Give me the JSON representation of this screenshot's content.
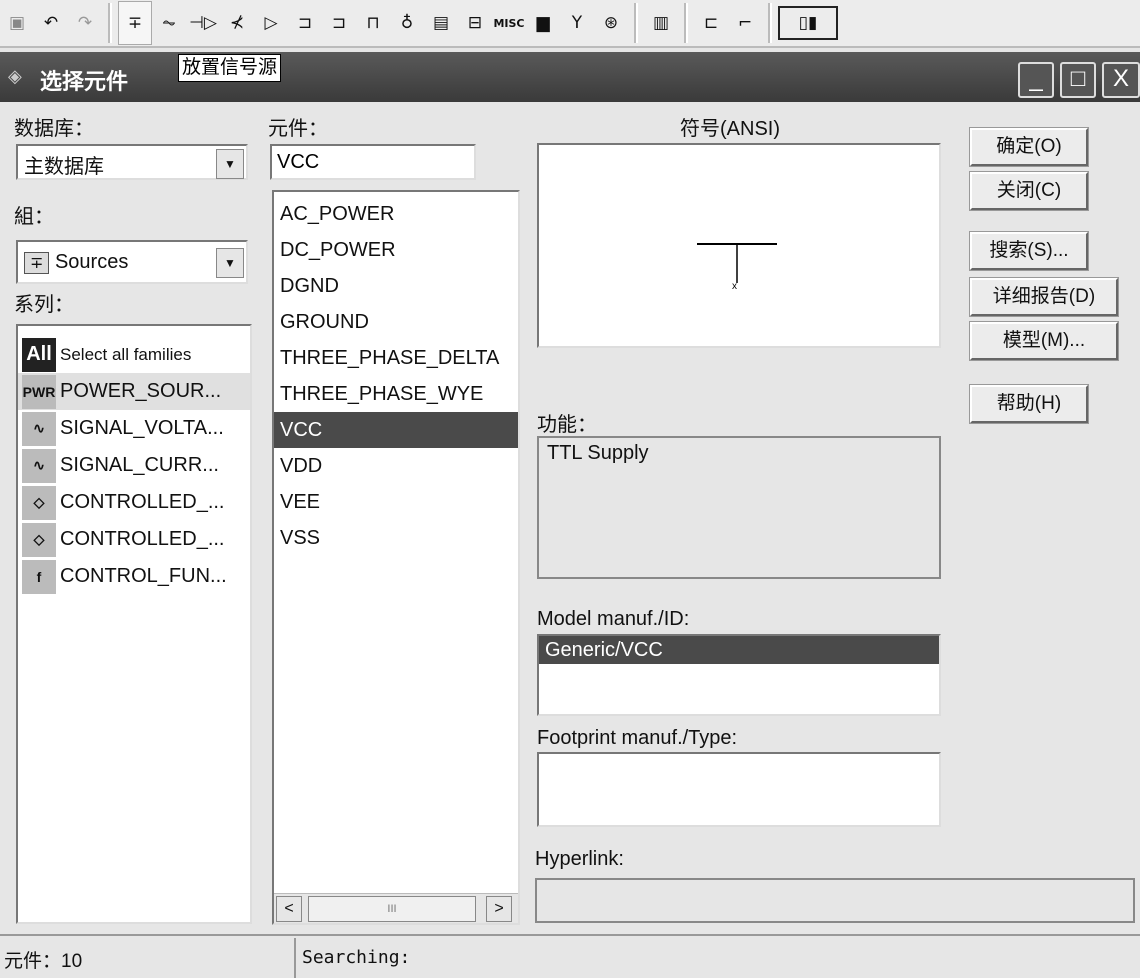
{
  "toolbar": {
    "icons": [
      "paste-icon",
      "undo-icon",
      "redo-icon",
      "source-icon",
      "resistor-icon",
      "diode-icon",
      "transistor-icon",
      "analog-icon",
      "ttl-icon",
      "cmos-icon",
      "mcu-icon",
      "indicator-icon",
      "misc-digital-icon",
      "power-component-icon",
      "misc-label",
      "electromechanical-icon",
      "antenna-icon",
      "motor-icon",
      "ic-icon",
      "hierarchy-icon",
      "bus-icon",
      "instrument-icon"
    ],
    "misc_label": "MISC",
    "tooltip": "放置信号源"
  },
  "dialog": {
    "title": "选择元件"
  },
  "database": {
    "label": "数据库：",
    "value": "主数据库"
  },
  "group": {
    "label": "組：",
    "value": "Sources"
  },
  "family": {
    "label": "系列：",
    "items": [
      {
        "icon": "All",
        "label": "Select all families"
      },
      {
        "icon": "PWR",
        "label": "POWER_SOUR..."
      },
      {
        "icon": "∿",
        "label": "SIGNAL_VOLTA..."
      },
      {
        "icon": "∿",
        "label": "SIGNAL_CURR..."
      },
      {
        "icon": "◇",
        "label": "CONTROLLED_..."
      },
      {
        "icon": "◇",
        "label": "CONTROLLED_..."
      },
      {
        "icon": "f",
        "label": "CONTROL_FUN..."
      }
    ]
  },
  "component": {
    "label": "元件：",
    "value": "VCC",
    "items": [
      "AC_POWER",
      "DC_POWER",
      "DGND",
      "GROUND",
      "THREE_PHASE_DELTA",
      "THREE_PHASE_WYE",
      "VCC",
      "VDD",
      "VEE",
      "VSS"
    ],
    "selected": "VCC",
    "scroll_thumb": "III"
  },
  "symbol": {
    "label": "符号(ANSI)"
  },
  "function": {
    "label": "功能：",
    "value": "TTL Supply"
  },
  "model": {
    "label": "Model manuf./ID:",
    "items": [
      "Generic/VCC"
    ]
  },
  "footprint": {
    "label": "Footprint manuf./Type:"
  },
  "hyperlink": {
    "label": "Hyperlink:",
    "value": ""
  },
  "buttons": {
    "ok": "确定(O)",
    "close": "关闭(C)",
    "search": "搜索(S)...",
    "detail": "详细报告(D)",
    "model": "模型(M)...",
    "help": "帮助(H)"
  },
  "status": {
    "count": "元件：10",
    "searching": "Searching:"
  }
}
